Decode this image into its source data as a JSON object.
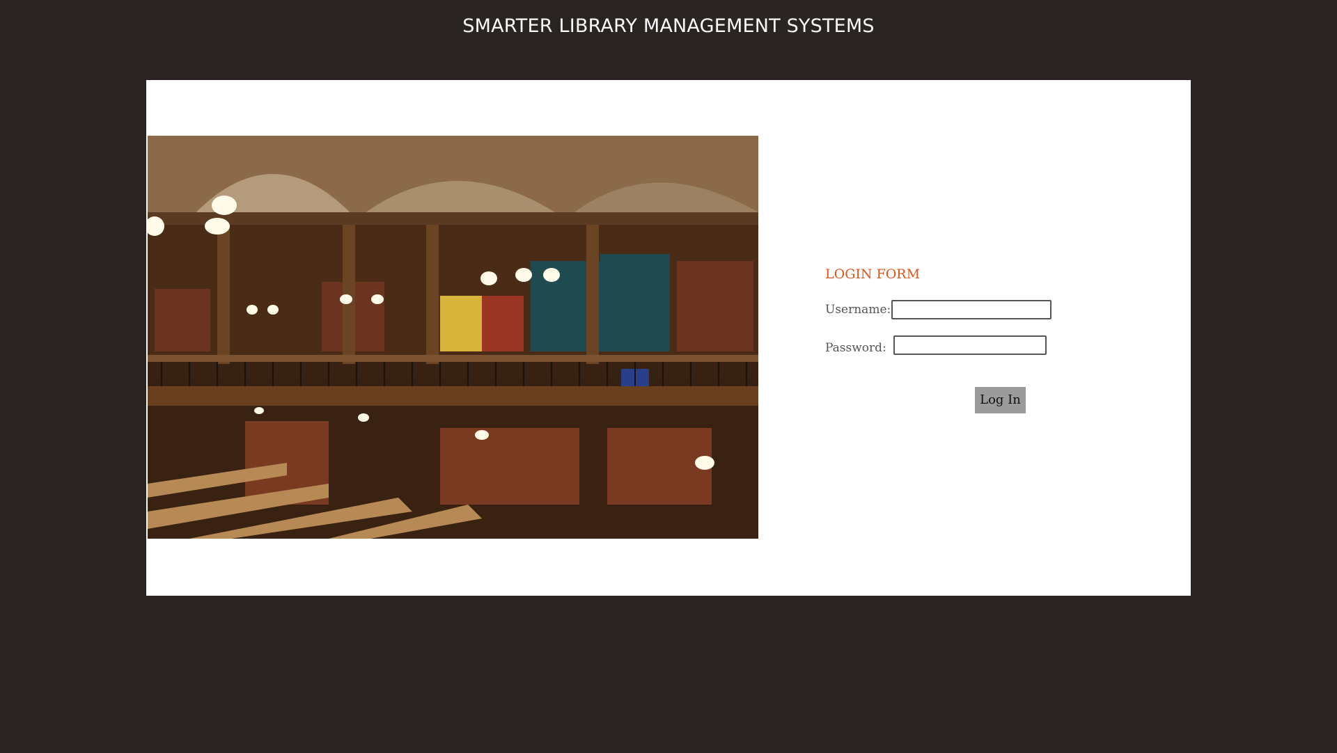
{
  "header": {
    "title": "SMARTER LIBRARY MANAGEMENT SYSTEMS"
  },
  "login": {
    "heading": "LOGIN FORM",
    "username_label": "Username:",
    "username_value": "",
    "password_label": "Password:",
    "password_value": "",
    "submit_label": "Log In"
  },
  "colors": {
    "page_background": "#2a2522",
    "panel_background": "#ffffff",
    "heading_accent": "#e0541a",
    "button_background": "#9b9b9b"
  }
}
